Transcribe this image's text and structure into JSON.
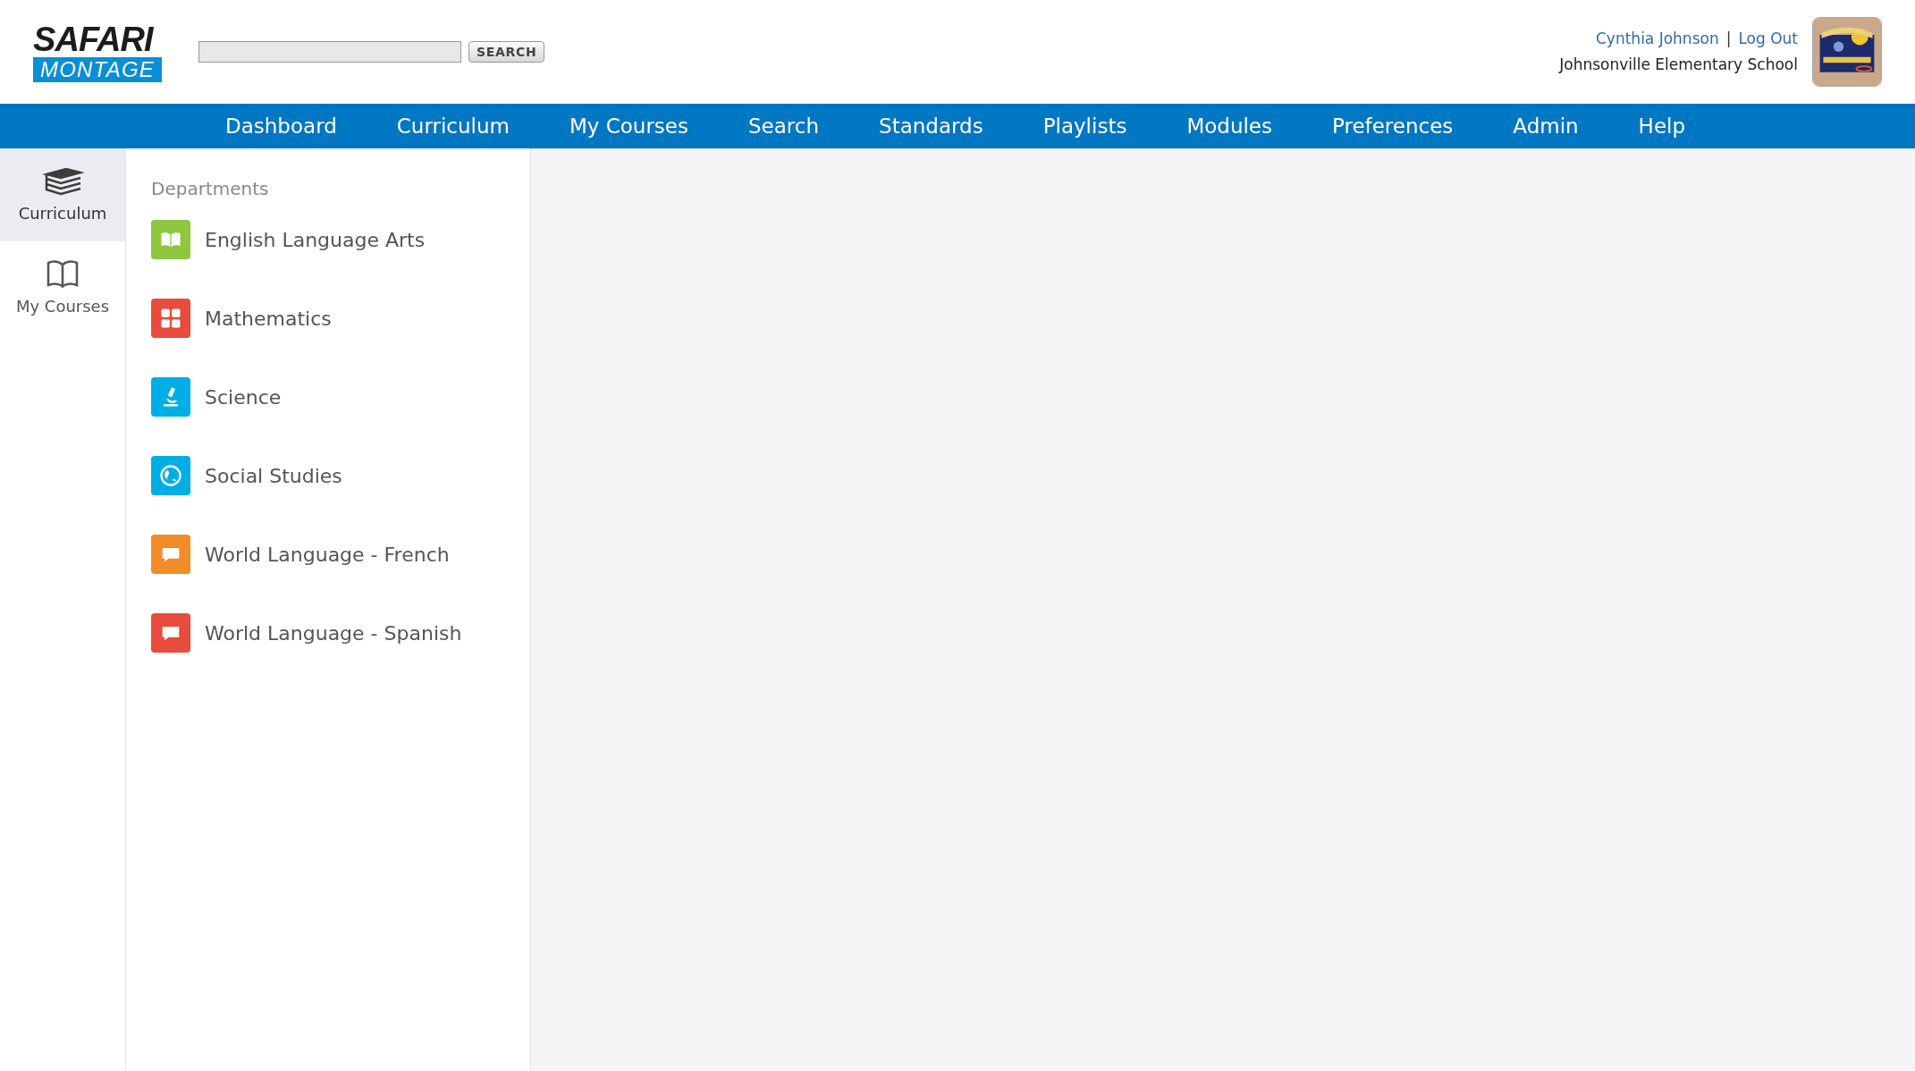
{
  "logo": {
    "top": "SAFARI",
    "bottom": "MONTAGE"
  },
  "search": {
    "button": "SEARCH"
  },
  "user": {
    "name": "Cynthia Johnson",
    "separator": "|",
    "logout": "Log Out",
    "school": "Johnsonville Elementary School"
  },
  "nav": [
    {
      "label": "Dashboard"
    },
    {
      "label": "Curriculum"
    },
    {
      "label": "My Courses"
    },
    {
      "label": "Search"
    },
    {
      "label": "Standards"
    },
    {
      "label": "Playlists"
    },
    {
      "label": "Modules"
    },
    {
      "label": "Preferences"
    },
    {
      "label": "Admin"
    },
    {
      "label": "Help"
    }
  ],
  "rail": [
    {
      "label": "Curriculum",
      "kind": "books",
      "selected": true
    },
    {
      "label": "My Courses",
      "kind": "book",
      "selected": false
    }
  ],
  "departments": {
    "heading": "Departments",
    "items": [
      {
        "label": "English Language Arts",
        "kind": "book",
        "color": "#8dc63f"
      },
      {
        "label": "Mathematics",
        "kind": "calculator",
        "color": "#e84c3d"
      },
      {
        "label": "Science",
        "kind": "microscope",
        "color": "#00aee6"
      },
      {
        "label": "Social Studies",
        "kind": "globe",
        "color": "#00aee6"
      },
      {
        "label": "World Language - French",
        "kind": "chat",
        "color": "#f28c28"
      },
      {
        "label": "World Language - Spanish",
        "kind": "chat",
        "color": "#e84c3d"
      }
    ]
  }
}
